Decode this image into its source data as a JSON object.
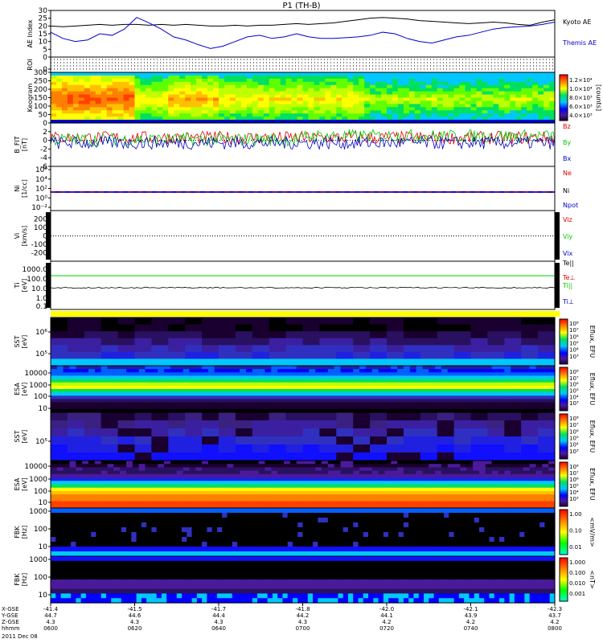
{
  "title": "P1 (TH-B)",
  "chart_data": {
    "type": "multi-panel",
    "panels": [
      {
        "id": "ae",
        "type": "line",
        "ylabel": "AE Index",
        "yticks": [
          "30",
          "25",
          "20",
          "15",
          "10",
          "5",
          "0"
        ],
        "ylim": [
          0,
          30
        ],
        "series": [
          {
            "name": "Kyoto AE",
            "color": "#000000",
            "y": [
              20,
              19.5,
              20,
              20.5,
              21,
              20.5,
              21,
              21,
              20.5,
              21,
              20.5,
              21,
              20.5,
              20,
              20,
              20.5,
              20,
              20.5,
              20.5,
              21,
              21.5,
              21,
              21.5,
              22,
              23,
              24,
              25,
              25.5,
              25,
              24.5,
              23.5,
              23,
              22.5,
              22,
              21.5,
              22,
              22.5,
              22,
              21,
              20.5,
              22.5,
              24
            ]
          },
          {
            "name": "Themis AE",
            "color": "#0000cc",
            "y": [
              16,
              12,
              10,
              11,
              15,
              14,
              18,
              25.5,
              22,
              18,
              13,
              11,
              8,
              5.5,
              7,
              10,
              13,
              14,
              12,
              13,
              15,
              13,
              12,
              12,
              12.5,
              13,
              14,
              16,
              15,
              12,
              10,
              9,
              11,
              13,
              14,
              16,
              18,
              19,
              19.5,
              20,
              21,
              22.5
            ]
          }
        ]
      },
      {
        "id": "roi",
        "type": "line",
        "ylabel": "ROI",
        "yticks": [
          "0"
        ]
      },
      {
        "id": "keogram",
        "type": "heatmap",
        "ylabel": "Keogram",
        "yticks": [
          "300",
          "250",
          "200",
          "150",
          "100",
          "50",
          "0"
        ],
        "ylim": [
          0,
          300
        ],
        "colorbar": {
          "label": "[counts]",
          "ticks": [
            "1.2×10⁴",
            "1.0×10⁴",
            "8.0×10³",
            "6.0×10³",
            "4.0×10³"
          ]
        }
      },
      {
        "id": "bfield",
        "type": "line",
        "ylabel": "B_FIT",
        "ylabel2": "[nT]",
        "yticks": [
          "2",
          "0",
          "-2",
          "-4",
          "-6"
        ],
        "ylim": [
          -6,
          4
        ],
        "series": [
          {
            "name": "Bz",
            "color": "#e00000"
          },
          {
            "name": "By",
            "color": "#00cc00"
          },
          {
            "name": "Bx",
            "color": "#0000cc"
          }
        ]
      },
      {
        "id": "density",
        "type": "line",
        "ylabel": "Ni",
        "ylabel2": "[1/cc]",
        "yticks": [
          "10⁶",
          "10⁴",
          "10²",
          "10⁰",
          "10⁻²"
        ],
        "series": [
          {
            "name": "Ne",
            "color": "#e00000"
          },
          {
            "name": "Ni",
            "color": "#000000"
          },
          {
            "name": "Npot",
            "color": "#0000cc"
          }
        ]
      },
      {
        "id": "velocity",
        "type": "line",
        "ylabel": "Vi",
        "ylabel2": "[km/s]",
        "yticks": [
          "200",
          "100",
          "0",
          "-100",
          "-200"
        ],
        "ylim": [
          -300,
          300
        ],
        "series": [
          {
            "name": "Viz",
            "color": "#e00000"
          },
          {
            "name": "Viy",
            "color": "#00cc00"
          },
          {
            "name": "Vix",
            "color": "#0000cc"
          }
        ]
      },
      {
        "id": "temperature",
        "type": "line",
        "ylabel": "Ti",
        "ylabel2": "[eV]",
        "yticks": [
          "1000.0",
          "100.0",
          "10.0",
          "1.0",
          "0.1"
        ],
        "series": [
          {
            "name": "Te||",
            "color": "#000000"
          },
          {
            "name": "Te⊥",
            "color": "#e00000"
          },
          {
            "name": "Ti||",
            "color": "#00cc00"
          },
          {
            "name": "Ti⊥",
            "color": "#0000cc"
          }
        ]
      },
      {
        "id": "sst_i",
        "type": "heatmap",
        "ylabel": "SST",
        "ylabel2": "[eV]",
        "yticks": [
          "10⁶",
          "10⁵"
        ],
        "colorbar": {
          "label": "Eflux, EFU",
          "ticks": [
            "10⁸",
            "10⁷",
            "10⁶",
            "10⁵",
            "10⁴",
            "10³"
          ]
        }
      },
      {
        "id": "esa_i",
        "type": "heatmap",
        "ylabel": "ESA",
        "ylabel2": "[eV]",
        "yticks": [
          "10000",
          "1000",
          "100",
          "10"
        ],
        "colorbar": {
          "label": "Eflux, EFU",
          "ticks": [
            "10⁸",
            "10⁷",
            "10⁶",
            "10⁵",
            "10⁴",
            "10³"
          ]
        }
      },
      {
        "id": "sst_e",
        "type": "heatmap",
        "ylabel": "SST",
        "ylabel2": "[eV]",
        "yticks": [
          "10⁵"
        ],
        "colorbar": {
          "label": "Eflux, EFU",
          "ticks": [
            "10⁸",
            "10⁷",
            "10⁶",
            "10⁵",
            "10⁴",
            "10³"
          ]
        }
      },
      {
        "id": "esa_e",
        "type": "heatmap",
        "ylabel": "ESA",
        "ylabel2": "[eV]",
        "yticks": [
          "10000",
          "1000",
          "100",
          "10"
        ],
        "colorbar": {
          "label": "Eflux, EFU",
          "ticks": [
            "10⁸",
            "10⁷",
            "10⁶",
            "10⁵",
            "10⁴",
            "10³"
          ]
        }
      },
      {
        "id": "fbk_e",
        "type": "heatmap",
        "ylabel": "FBK",
        "ylabel2": "[Hz]",
        "yticks": [
          "1000",
          "100",
          "10"
        ],
        "colorbar": {
          "label": "<mV/m>",
          "ticks": [
            "1.00",
            "0.10",
            "0.01"
          ]
        }
      },
      {
        "id": "fbk_b",
        "type": "heatmap",
        "ylabel": "FBK",
        "ylabel2": "[Hz]",
        "yticks": [
          "1000",
          "100",
          "10"
        ],
        "colorbar": {
          "label": "<nT>",
          "ticks": [
            "1.000",
            "0.100",
            "0.010",
            "0.001"
          ]
        }
      }
    ],
    "x_axis": {
      "row_labels": [
        "X-GSE",
        "Y-GSE",
        "Z-GSE",
        "hhmm"
      ],
      "ticks": [
        {
          "x": "-41.4",
          "y": "44.7",
          "z": "4.3",
          "t": "0600"
        },
        {
          "x": "-41.5",
          "y": "44.6",
          "z": "4.3",
          "t": "0620"
        },
        {
          "x": "-41.7",
          "y": "44.4",
          "z": "4.3",
          "t": "0640"
        },
        {
          "x": "-41.8",
          "y": "44.2",
          "z": "4.3",
          "t": "0700"
        },
        {
          "x": "-42.0",
          "y": "44.1",
          "z": "4.2",
          "t": "0720"
        },
        {
          "x": "-42.1",
          "y": "43.9",
          "z": "4.2",
          "t": "0740"
        },
        {
          "x": "-42.3",
          "y": "43.7",
          "z": "4.2",
          "t": "0800"
        }
      ],
      "date": "2011 Dec 08"
    }
  }
}
